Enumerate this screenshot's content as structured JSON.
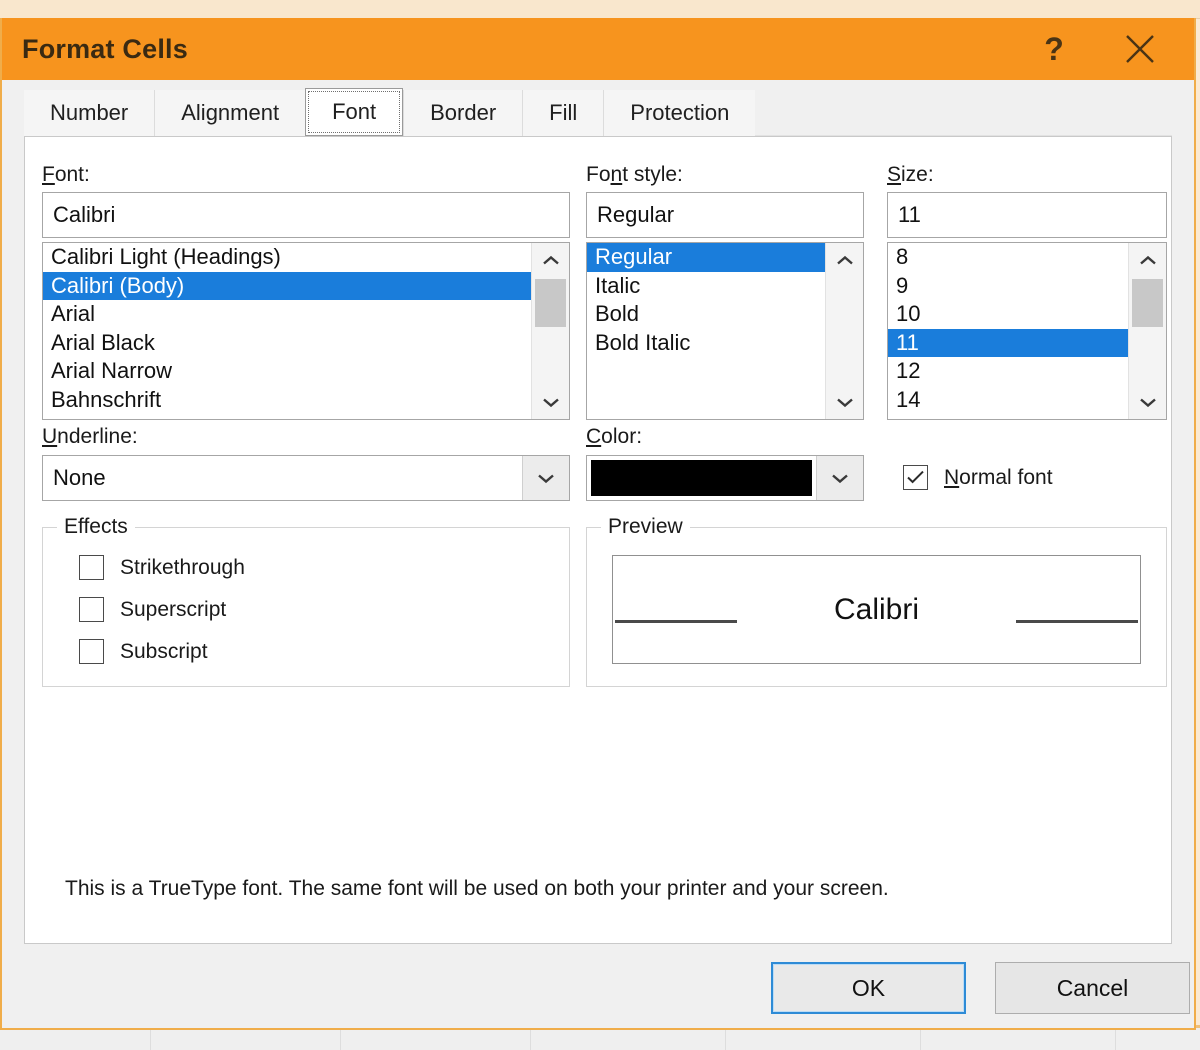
{
  "dialog": {
    "title": "Format Cells",
    "help_icon": "question-mark-icon",
    "close_icon": "close-icon",
    "accent_color": "#F7941E",
    "highlight_color": "#1A7DDB"
  },
  "tabs": [
    {
      "label": "Number",
      "selected": false
    },
    {
      "label": "Alignment",
      "selected": false
    },
    {
      "label": "Font",
      "selected": true
    },
    {
      "label": "Border",
      "selected": false
    },
    {
      "label": "Fill",
      "selected": false
    },
    {
      "label": "Protection",
      "selected": false
    }
  ],
  "font": {
    "label": "Font:",
    "label_prefix": "F",
    "label_rest": "ont:",
    "value": "Calibri",
    "items": [
      {
        "label": "Calibri Light (Headings)",
        "selected": false
      },
      {
        "label": "Calibri (Body)",
        "selected": true
      },
      {
        "label": "Arial",
        "selected": false
      },
      {
        "label": "Arial Black",
        "selected": false
      },
      {
        "label": "Arial Narrow",
        "selected": false
      },
      {
        "label": "Bahnschrift",
        "selected": false
      }
    ]
  },
  "font_style": {
    "label": "Font style:",
    "label_prefix": "Fo",
    "label_rest": "nt style:",
    "value": "Regular",
    "items": [
      {
        "label": "Regular",
        "selected": true
      },
      {
        "label": "Italic",
        "selected": false
      },
      {
        "label": "Bold",
        "selected": false
      },
      {
        "label": "Bold Italic",
        "selected": false
      }
    ]
  },
  "size": {
    "label": "Size:",
    "label_prefix": "S",
    "label_rest": "ize:",
    "value": "11",
    "items": [
      {
        "label": "8",
        "selected": false
      },
      {
        "label": "9",
        "selected": false
      },
      {
        "label": "10",
        "selected": false
      },
      {
        "label": "11",
        "selected": true
      },
      {
        "label": "12",
        "selected": false
      },
      {
        "label": "14",
        "selected": false
      }
    ]
  },
  "underline": {
    "label": "Underline:",
    "label_prefix": "U",
    "label_rest": "nderline:",
    "value": "None"
  },
  "color": {
    "label": "Color:",
    "label_prefix": "C",
    "label_rest": "olor:",
    "value": "#000000"
  },
  "normal_font": {
    "label": "Normal font",
    "label_prefix": "N",
    "label_rest": "ormal font",
    "checked": true,
    "check_glyph": "✓"
  },
  "effects": {
    "legend": "Effects",
    "items": [
      {
        "label": "Strikethrough",
        "checked": false
      },
      {
        "label": "Superscript",
        "checked": false
      },
      {
        "label": "Subscript",
        "checked": false
      }
    ]
  },
  "preview": {
    "legend": "Preview",
    "sample_text": "Calibri"
  },
  "description": "This is a TrueType font.  The same font will be used on both your printer and your screen.",
  "buttons": {
    "ok": "OK",
    "cancel": "Cancel"
  }
}
